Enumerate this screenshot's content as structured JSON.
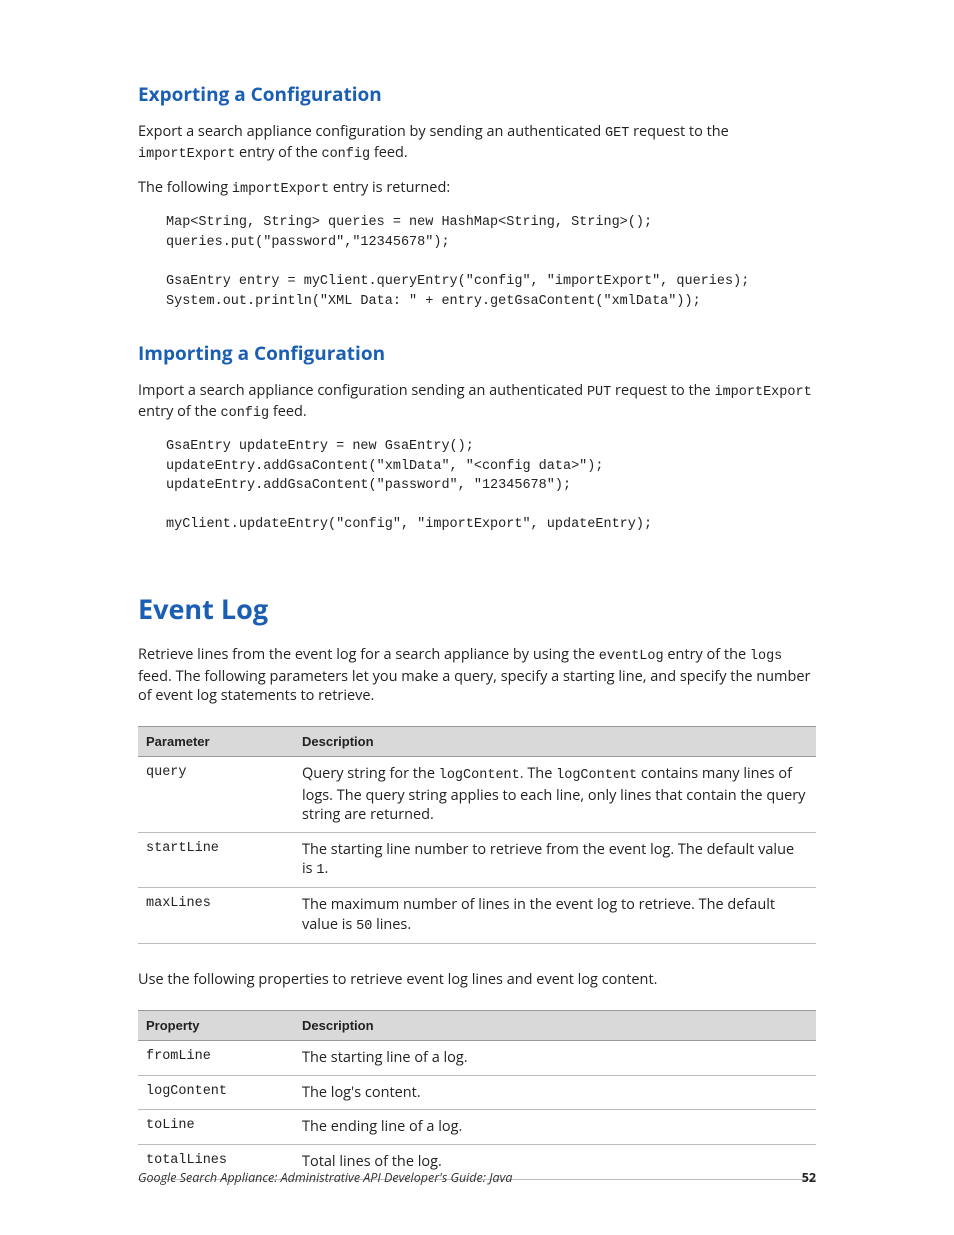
{
  "sections": {
    "export": {
      "heading": "Exporting a Configuration",
      "para1_pre": "Export a search appliance configuration by sending an authenticated ",
      "para1_code1": "GET",
      "para1_mid": " request to the ",
      "para1_code2": "importExport",
      "para1_post": " entry of the ",
      "para1_code3": "config",
      "para1_tail": " feed.",
      "para2_pre": "The following ",
      "para2_code": "importExport",
      "para2_post": " entry is returned:",
      "code": "Map<String, String> queries = new HashMap<String, String>();\nqueries.put(\"password\",\"12345678\");\n\nGsaEntry entry = myClient.queryEntry(\"config\", \"importExport\", queries);\nSystem.out.println(\"XML Data: \" + entry.getGsaContent(\"xmlData\"));"
    },
    "import": {
      "heading": "Importing a Configuration",
      "para1_pre": "Import a search appliance configuration sending an authenticated ",
      "para1_code1": "PUT",
      "para1_mid": " request to the ",
      "para1_code2": "importExport",
      "para1_post": " entry of the ",
      "para1_code3": "config",
      "para1_tail": " feed.",
      "code": "GsaEntry updateEntry = new GsaEntry();\nupdateEntry.addGsaContent(\"xmlData\", \"<config data>\");\nupdateEntry.addGsaContent(\"password\", \"12345678\");\n\nmyClient.updateEntry(\"config\", \"importExport\", updateEntry);"
    },
    "eventlog": {
      "heading": "Event Log",
      "para1_pre": "Retrieve lines from the event log for a search appliance by using the ",
      "para1_code1": "eventLog",
      "para1_mid": " entry of the ",
      "para1_code2": "logs",
      "para1_post": " feed. The following parameters let you make a query, specify a starting line, and specify the number of event log statements to retrieve.",
      "table1": {
        "h1": "Parameter",
        "h2": "Description",
        "rows": [
          {
            "p": "query",
            "d_pre": "Query string for the ",
            "d_c1": "logContent",
            "d_mid": ". The ",
            "d_c2": "logContent",
            "d_post": " contains many lines of logs. The query string applies to each line, only lines that contain the query string are returned."
          },
          {
            "p": "startLine",
            "d_pre": "The starting line number to retrieve from the event log. The default value is ",
            "d_c1": "1",
            "d_post": "."
          },
          {
            "p": "maxLines",
            "d_pre": "The maximum number of lines in the event log to retrieve. The default value is ",
            "d_c1": "50",
            "d_post": " lines."
          }
        ]
      },
      "para2": "Use the following properties to retrieve event log lines and event log content.",
      "table2": {
        "h1": "Property",
        "h2": "Description",
        "rows": [
          {
            "p": "fromLine",
            "d": "The starting line of a log."
          },
          {
            "p": "logContent",
            "d": "The log's content."
          },
          {
            "p": "toLine",
            "d": "The ending line of a log."
          },
          {
            "p": "totalLines",
            "d": "Total lines of the log."
          }
        ]
      }
    }
  },
  "footer": {
    "left": "Google Search Appliance: Administrative API Developer's Guide: Java",
    "right": "52"
  }
}
